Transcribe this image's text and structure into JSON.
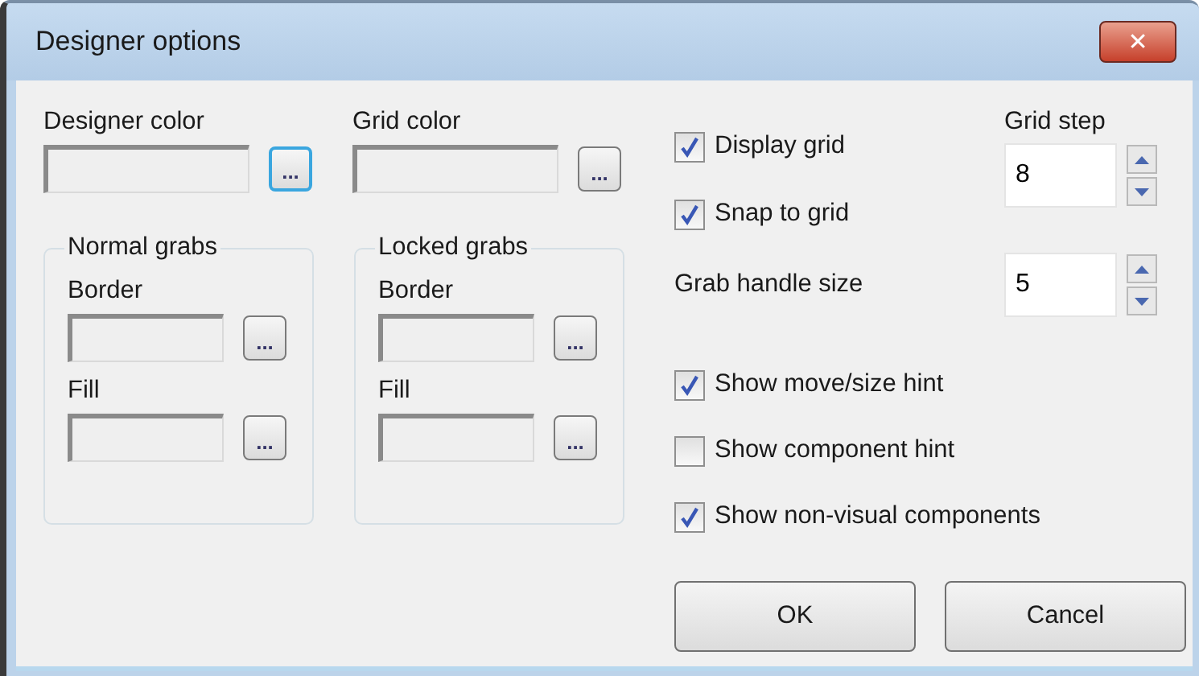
{
  "window": {
    "title": "Designer options",
    "close": "✕"
  },
  "color_fields": [
    {
      "label": "Designer color",
      "button": "...",
      "focused": true
    },
    {
      "label": "Grid color",
      "button": "...",
      "focused": false
    }
  ],
  "groups": [
    {
      "title": "Normal grabs",
      "fields": [
        {
          "label": "Border",
          "button": "..."
        },
        {
          "label": "Fill",
          "button": "..."
        }
      ]
    },
    {
      "title": "Locked grabs",
      "fields": [
        {
          "label": "Border",
          "button": "..."
        },
        {
          "label": "Fill",
          "button": "..."
        }
      ]
    }
  ],
  "grid_options": [
    {
      "label": "Display grid",
      "checked": true
    },
    {
      "label": "Snap to grid",
      "checked": true
    }
  ],
  "grid_step": {
    "label": "Grid step",
    "value": "8"
  },
  "grab_handle_size": {
    "label": "Grab handle size",
    "value": "5"
  },
  "hint_options": [
    {
      "label": "Show move/size hint",
      "checked": true
    },
    {
      "label": "Show component hint",
      "checked": false
    },
    {
      "label": "Show non-visual components",
      "checked": true
    }
  ],
  "buttons": [
    "OK",
    "Cancel"
  ]
}
